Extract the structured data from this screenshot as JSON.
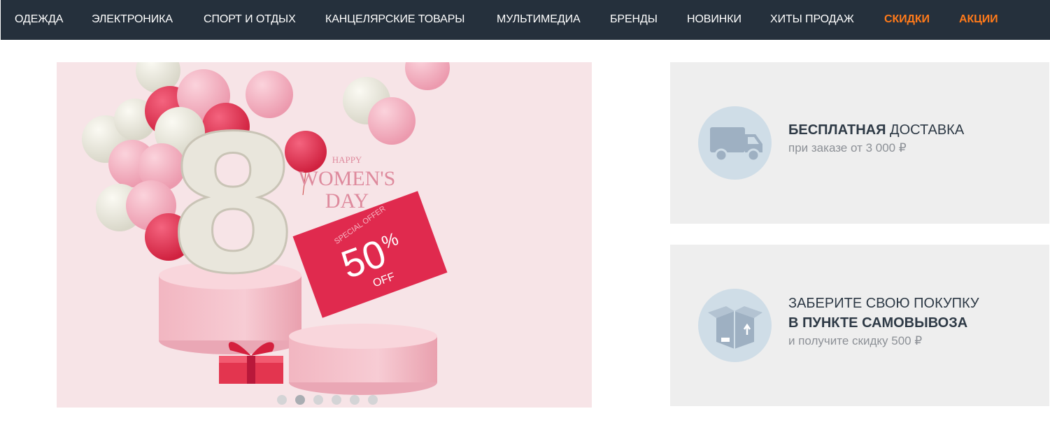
{
  "nav": {
    "items": [
      {
        "label": "ОДЕЖДА",
        "accent": false
      },
      {
        "label": "ЭЛЕКТРОНИКА",
        "accent": false
      },
      {
        "label": "СПОРТ И ОТДЫХ",
        "accent": false
      },
      {
        "label": "КАНЦЕЛЯРСКИЕ ТОВАРЫ",
        "accent": false
      },
      {
        "label": "МУЛЬТИМЕДИА",
        "accent": false
      },
      {
        "label": "БРЕНДЫ",
        "accent": false
      },
      {
        "label": "НОВИНКИ",
        "accent": false
      },
      {
        "label": "ХИТЫ ПРОДАЖ",
        "accent": false
      },
      {
        "label": "СКИДКИ",
        "accent": true
      },
      {
        "label": "АКЦИИ",
        "accent": true
      }
    ],
    "accent_color": "#ff7a1a",
    "background": "#25303c"
  },
  "banner": {
    "happy": "HAPPY",
    "title1": "WOMEN'S",
    "title2": "DAY",
    "big_number": "8",
    "tag_special": "SPECIAL OFFER",
    "tag_percent": "50",
    "tag_percent_sign": "%",
    "tag_off": "OFF",
    "dots_count": 6,
    "active_dot": 1
  },
  "delivery": {
    "icon": "truck-icon",
    "title_bold": "БЕСПЛАТНАЯ",
    "title_rest": " ДОСТАВКА",
    "subtitle": "при заказе от 3 000 ₽"
  },
  "pickup": {
    "icon": "box-icon",
    "line1": "ЗАБЕРИТЕ СВОЮ ПОКУПКУ",
    "line2": "В ПУНКТЕ САМОВЫВОЗА",
    "subtitle": "и получите скидку 500 ₽"
  }
}
